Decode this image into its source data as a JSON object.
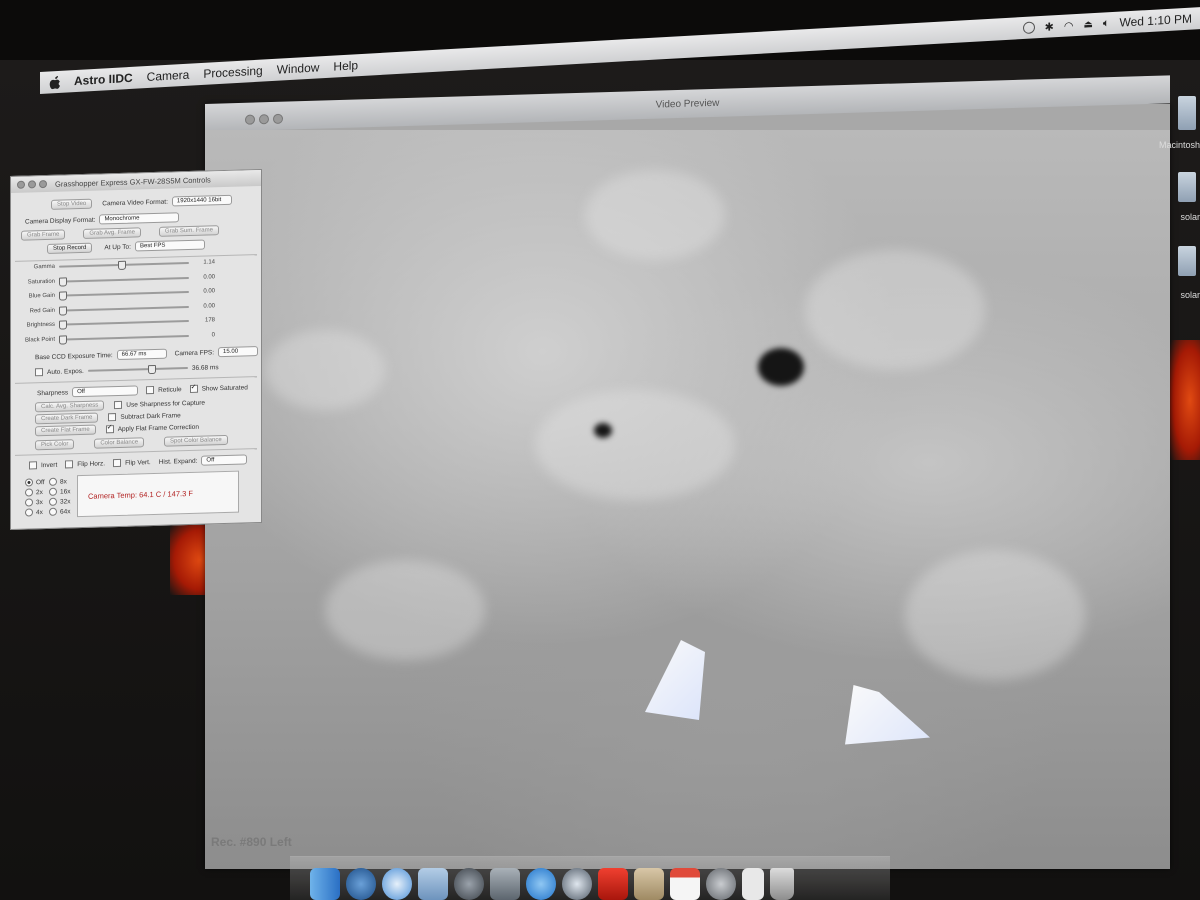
{
  "menubar": {
    "app_name": "Astro IIDC",
    "menus": [
      "Camera",
      "Processing",
      "Window",
      "Help"
    ],
    "clock": "Wed 1:10 PM"
  },
  "preview": {
    "title": "Video Preview",
    "rec_label": "Rec. #890 Left"
  },
  "controls": {
    "title": "Grasshopper Express GX-FW-28S5M Controls",
    "stop_video_label": "Stop Video",
    "video_format_label": "Camera Video Format:",
    "video_format_value": "1920x1440 16bit",
    "display_format_label": "Camera Display Format:",
    "display_format_value": "Monochrome",
    "grab_frame_label": "Grab Frame",
    "grab_avg_frame_label": "Grab Avg. Frame",
    "grab_sum_frame_label": "Grab Sum. Frame",
    "stop_record_label": "Stop Record",
    "at_up_to_label": "At Up To:",
    "at_up_to_value": "Best FPS",
    "sliders": [
      {
        "label": "Gamma",
        "value": "1.14",
        "level": 0.45
      },
      {
        "label": "Saturation",
        "value": "0.00",
        "level": 0.0
      },
      {
        "label": "Blue Gain",
        "value": "0.00",
        "level": 0.0
      },
      {
        "label": "Red Gain",
        "value": "0.00",
        "level": 0.0
      },
      {
        "label": "Brightness",
        "value": "178",
        "level": 0.0
      },
      {
        "label": "Black Point",
        "value": "0",
        "level": 0.0
      }
    ],
    "exposure_label": "Base CCD Exposure Time:",
    "exposure_value": "66.67 ms",
    "fps_label": "Camera FPS:",
    "fps_value": "15.00",
    "auto_expos_label": "Auto. Expos.",
    "auto_expos_value": "36.68 ms",
    "sharpness_label": "Sharpness",
    "sharpness_value": "Off",
    "reticule_label": "Reticule",
    "show_saturated_label": "Show Saturated",
    "use_sharpness_label": "Use Sharpness for Capture",
    "subtract_dark_label": "Subtract Dark Frame",
    "apply_flat_label": "Apply Flat Frame Correction",
    "calc_avg_sharpness_label": "Calc. Avg. Sharpness",
    "create_dark_label": "Create Dark Frame",
    "create_flat_label": "Create Flat Frame",
    "pick_color_label": "Pick Color",
    "color_balance_label": "Color Balance",
    "spot_color_balance_label": "Spot Color Balance",
    "invert_label": "Invert",
    "flip_horz_label": "Flip Horz.",
    "flip_vert_label": "Flip Vert.",
    "hist_expand_label": "Hist. Expand:",
    "hist_expand_value": "Off",
    "zoom_options": [
      "Off",
      "8x",
      "2x",
      "16x",
      "3x",
      "32x",
      "4x",
      "64x"
    ],
    "camera_temp": "Camera Temp: 64.1 C / 147.3 F"
  },
  "desktop": {
    "items": [
      "Macintosh",
      "solar",
      "solar"
    ]
  }
}
